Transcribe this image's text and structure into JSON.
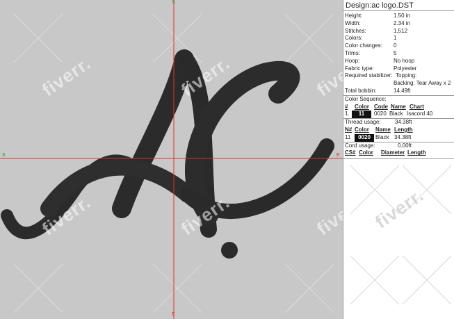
{
  "design": {
    "title": "Design:ac logo.DST"
  },
  "properties": [
    {
      "label": "Height:",
      "value": "1.50 in"
    },
    {
      "label": "Width:",
      "value": "2.34 in"
    },
    {
      "label": "Stitches:",
      "value": "1,512"
    },
    {
      "label": "Colors:",
      "value": "1"
    },
    {
      "label": "Color changes:",
      "value": "0"
    },
    {
      "label": "Trims:",
      "value": "5"
    },
    {
      "label": "Hoop:",
      "value": "No hoop"
    },
    {
      "label": "Fabric type:",
      "value": "Polyester"
    },
    {
      "label": "Required stabilizer:",
      "value": "Topping:"
    },
    {
      "label": "",
      "value": "Backing: Tear Away x 2"
    },
    {
      "label": "Total bobbin:",
      "value": "14.49ft"
    }
  ],
  "color_sequence": {
    "title": "Color Sequence:",
    "headers": [
      "#",
      "Color",
      "Code",
      "Name",
      "Chart"
    ],
    "rows": [
      {
        "num": "1.",
        "color": "11",
        "code": "0020",
        "name": "Black",
        "chart": "Isacord 40"
      }
    ],
    "chip_color": "#111111"
  },
  "thread_usage": {
    "label": "Thread usage:",
    "value": "34.38ft",
    "headers": [
      "N#",
      "Color",
      "Name",
      "Length"
    ],
    "rows": [
      {
        "num": "11",
        "color": "0020",
        "name": "Black",
        "length": "34.38ft"
      }
    ]
  },
  "cord_usage": {
    "label": "Cord usage:",
    "value": "0.00ft",
    "headers": [
      "CS#",
      "Color",
      "Diameter",
      "Length"
    ]
  },
  "canvas": {
    "axis_labels": {
      "top": "S",
      "left": "S",
      "bottom": "E",
      "right": "E"
    },
    "background": "#c8c8c8",
    "guide_color": "#e03030",
    "thread_color": "#2a2a2a"
  },
  "watermark": {
    "text": "fiverr."
  }
}
